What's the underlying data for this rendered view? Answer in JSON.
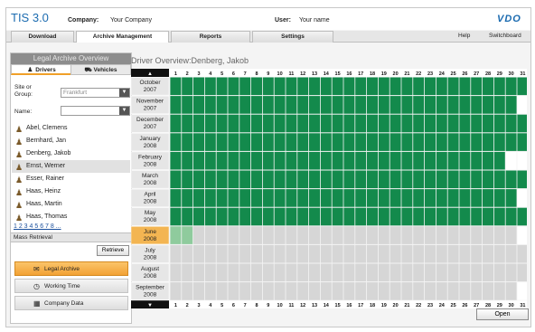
{
  "header": {
    "app_title": "TIS 3.0",
    "company_label": "Company:",
    "company_value": "Your Company",
    "user_label": "User:",
    "user_value": "Your name",
    "logo_text": "VDO"
  },
  "menu": {
    "items": [
      {
        "label": "Download",
        "active": false
      },
      {
        "label": "Archive Management",
        "active": true
      },
      {
        "label": "Reports",
        "active": false
      },
      {
        "label": "Settings",
        "active": false
      }
    ],
    "help": "Help",
    "switchboard": "Switchboard"
  },
  "sidebar": {
    "title": "Legal Archive Overview",
    "tabs": [
      {
        "label": "Drivers",
        "icon": "driver-icon",
        "active": true
      },
      {
        "label": "Vehicles",
        "icon": "vehicle-icon",
        "active": false
      }
    ],
    "site_label_1": "Site or",
    "site_label_2": "Group:",
    "site_value": "Frankfurt",
    "name_label": "Name:",
    "name_value": "",
    "drivers": [
      {
        "name": "Abel, Clemens",
        "selected": false
      },
      {
        "name": "Bernhard, Jan",
        "selected": false
      },
      {
        "name": "Denberg, Jakob",
        "selected": false
      },
      {
        "name": "Ernst, Werner",
        "selected": true
      },
      {
        "name": "Esser, Rainer",
        "selected": false
      },
      {
        "name": "Haas, Heinz",
        "selected": false
      },
      {
        "name": "Haas, Martin",
        "selected": false
      },
      {
        "name": "Haas, Thomas",
        "selected": false
      }
    ],
    "pager": "1 2 3 4 5 6 7 8 ...",
    "mass_retrieval": "Mass Retrieval",
    "retrieve_button": "Retrieve",
    "nav": [
      {
        "label": "Legal Archive",
        "icon": "archive-icon",
        "active": true
      },
      {
        "label": "Working Time",
        "icon": "clock-icon",
        "active": false
      },
      {
        "label": "Company Data",
        "icon": "company-icon",
        "active": false
      }
    ]
  },
  "main": {
    "title": "Driver Overview:Denberg, Jakob",
    "open_button": "Open",
    "up_arrow": "▲",
    "down_arrow": "▼"
  },
  "colors": {
    "filled": "#138a4c",
    "partial": "#8fcb9d",
    "empty": "#d6d6d6",
    "current_month": "#f3b552",
    "month_cell": "#e6e6e6",
    "accent": "#1b6bb0"
  },
  "calendar": {
    "days": [
      "1",
      "2",
      "3",
      "4",
      "5",
      "6",
      "7",
      "8",
      "9",
      "10",
      "11",
      "12",
      "13",
      "14",
      "15",
      "16",
      "17",
      "18",
      "19",
      "20",
      "21",
      "22",
      "23",
      "24",
      "25",
      "26",
      "27",
      "28",
      "29",
      "30",
      "31"
    ],
    "months": [
      {
        "month": "October",
        "year": "2007",
        "days_in_month": 31,
        "filled_through": 31,
        "partial_through": 0,
        "current": false
      },
      {
        "month": "November",
        "year": "2007",
        "days_in_month": 30,
        "filled_through": 30,
        "partial_through": 0,
        "current": false
      },
      {
        "month": "December",
        "year": "2007",
        "days_in_month": 31,
        "filled_through": 31,
        "partial_through": 0,
        "current": false
      },
      {
        "month": "January",
        "year": "2008",
        "days_in_month": 31,
        "filled_through": 31,
        "partial_through": 0,
        "current": false
      },
      {
        "month": "February",
        "year": "2008",
        "days_in_month": 29,
        "filled_through": 29,
        "partial_through": 0,
        "current": false
      },
      {
        "month": "March",
        "year": "2008",
        "days_in_month": 31,
        "filled_through": 31,
        "partial_through": 0,
        "current": false
      },
      {
        "month": "April",
        "year": "2008",
        "days_in_month": 30,
        "filled_through": 30,
        "partial_through": 0,
        "current": false
      },
      {
        "month": "May",
        "year": "2008",
        "days_in_month": 31,
        "filled_through": 31,
        "partial_through": 0,
        "current": false
      },
      {
        "month": "June",
        "year": "2008",
        "days_in_month": 30,
        "filled_through": 0,
        "partial_through": 2,
        "current": true
      },
      {
        "month": "July",
        "year": "2008",
        "days_in_month": 31,
        "filled_through": 0,
        "partial_through": 0,
        "current": false
      },
      {
        "month": "August",
        "year": "2008",
        "days_in_month": 31,
        "filled_through": 0,
        "partial_through": 0,
        "current": false
      },
      {
        "month": "September",
        "year": "2008",
        "days_in_month": 30,
        "filled_through": 0,
        "partial_through": 0,
        "current": false
      }
    ]
  }
}
